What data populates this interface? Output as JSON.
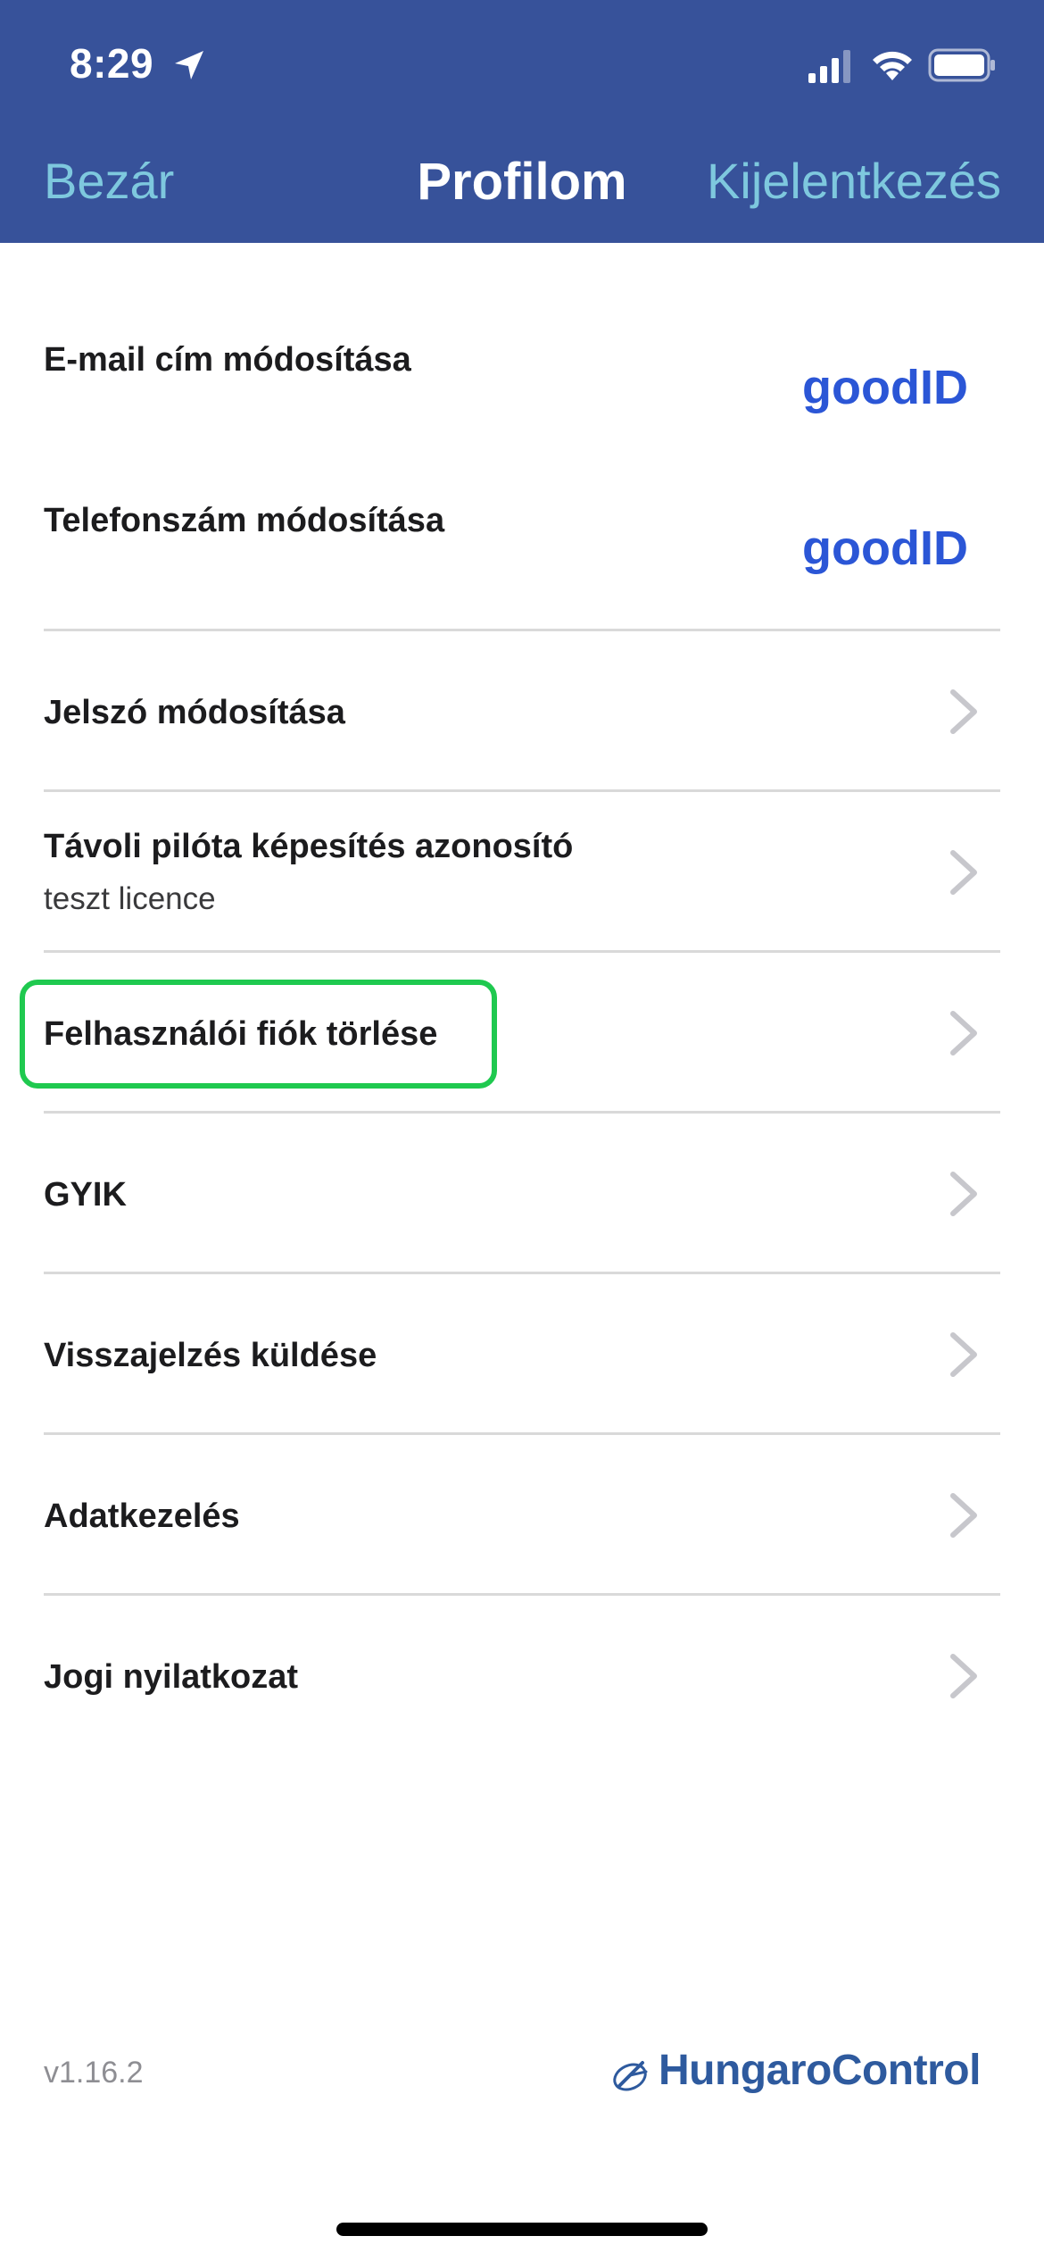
{
  "status_bar": {
    "time": "8:29"
  },
  "nav": {
    "close_label": "Bezár",
    "title": "Profilom",
    "logout_label": "Kijelentkezés"
  },
  "menu": {
    "items": [
      {
        "label": "E-mail cím módosítása",
        "badge": "goodID"
      },
      {
        "label": "Telefonszám módosítása",
        "badge": "goodID"
      },
      {
        "label": "Jelszó módosítása"
      },
      {
        "label": "Távoli pilóta képesítés azonosító",
        "sublabel": "teszt licence"
      },
      {
        "label": "Felhasználói fiók törlése"
      },
      {
        "label": "GYIK"
      },
      {
        "label": "Visszajelzés küldése"
      },
      {
        "label": "Adatkezelés"
      },
      {
        "label": "Jogi nyilatkozat"
      }
    ]
  },
  "footer": {
    "version": "v1.16.2",
    "brand": "HungaroControl"
  },
  "colors": {
    "header_bg": "#37529a",
    "nav_link": "#7ec8de",
    "highlight": "#1fc94f",
    "goodid": "#2b56d6",
    "brand": "#2e5a9e"
  }
}
